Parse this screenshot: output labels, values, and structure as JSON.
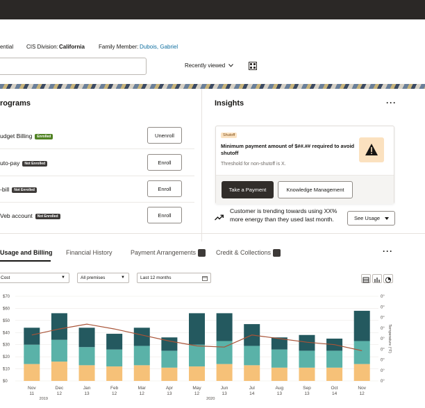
{
  "header": {
    "partial_label": "ential",
    "cis_division_label": "CIS Division:",
    "cis_division_value": "California",
    "family_member_label": "Family Member:",
    "family_member_value": "Dubois, Gabriel"
  },
  "search": {
    "placeholder": ""
  },
  "recently_viewed": "Recently viewed",
  "programs": {
    "title": "rograms",
    "items": [
      {
        "name": "udget Billing",
        "status": "Enrolled",
        "button": "Unenroll"
      },
      {
        "name": "uto-pay",
        "status": "Not Enrolled",
        "button": "Enroll"
      },
      {
        "name": "-bill",
        "status": "Not Enrolled",
        "button": "Enroll"
      },
      {
        "name": "Veb account",
        "status": "Not Enrolled",
        "button": "Enroll"
      }
    ]
  },
  "insights": {
    "title": "Insights",
    "card": {
      "tag": "Shutoff",
      "heading": "Minimum payment amount of $##.## required to avoid shutoff",
      "subtext": "Threshold for non-shutoff is X.",
      "primary_button": "Take a Payment",
      "secondary_button": "Knowledge Management"
    },
    "trend_text": "Customer is trending towards using XX% more energy than they used last month.",
    "trend_button": "See Usage"
  },
  "tabs": [
    {
      "label": "Usage and Billing",
      "active": true
    },
    {
      "label": "Financial History",
      "active": false
    },
    {
      "label": "Payment Arrangements",
      "active": false
    },
    {
      "label": "Credit & Collections",
      "active": false
    }
  ],
  "filters": {
    "metric": "Cost",
    "premises": "All premises",
    "period": "Last 12 months"
  },
  "colors": {
    "dark_teal": "#24595f",
    "teal": "#5ab2a8",
    "orange": "#f6c178",
    "line": "#a85337"
  },
  "chart_data": {
    "type": "bar",
    "stacked": true,
    "categories": [
      "Nov 11",
      "Dec 12",
      "Jan 13",
      "Feb 12",
      "Mar 12",
      "Apr 13",
      "May 12",
      "Jun 13",
      "Jul 14",
      "Aug 13",
      "Sep 13",
      "Oct 14",
      "Nov 12"
    ],
    "category_months": [
      "Nov",
      "Dec",
      "Jan",
      "Feb",
      "Mar",
      "Apr",
      "May",
      "Jun",
      "Jul",
      "Aug",
      "Sep",
      "Oct",
      "Nov"
    ],
    "category_days": [
      "11",
      "12",
      "13",
      "12",
      "12",
      "13",
      "12",
      "13",
      "14",
      "13",
      "13",
      "14",
      "12"
    ],
    "year_labels": [
      "2019",
      "2020"
    ],
    "series": [
      {
        "values": [
          14,
          16,
          13,
          12,
          13,
          11,
          12,
          14,
          13,
          11,
          11,
          11,
          14
        ]
      },
      {
        "values": [
          16,
          18,
          15,
          14,
          16,
          14,
          18,
          19,
          16,
          15,
          14,
          14,
          19
        ]
      },
      {
        "values": [
          14,
          22,
          16,
          13,
          15,
          11,
          26,
          23,
          18,
          10,
          13,
          10,
          25
        ]
      },
      {
        "line": true,
        "values": [
          38,
          43,
          47,
          43,
          38,
          33,
          29,
          28,
          38,
          35,
          32,
          30,
          25
        ]
      }
    ],
    "y_ticks": [
      "$0",
      "$10",
      "$20",
      "$30",
      "$40",
      "$50",
      "$60",
      "$70"
    ],
    "y2_ticks": [
      "0°",
      "0°",
      "0°",
      "0°",
      "0°",
      "0°",
      "0°",
      "0°",
      "0°"
    ],
    "y2_label": "Temperature (°F)",
    "ylim": [
      0,
      70
    ]
  }
}
